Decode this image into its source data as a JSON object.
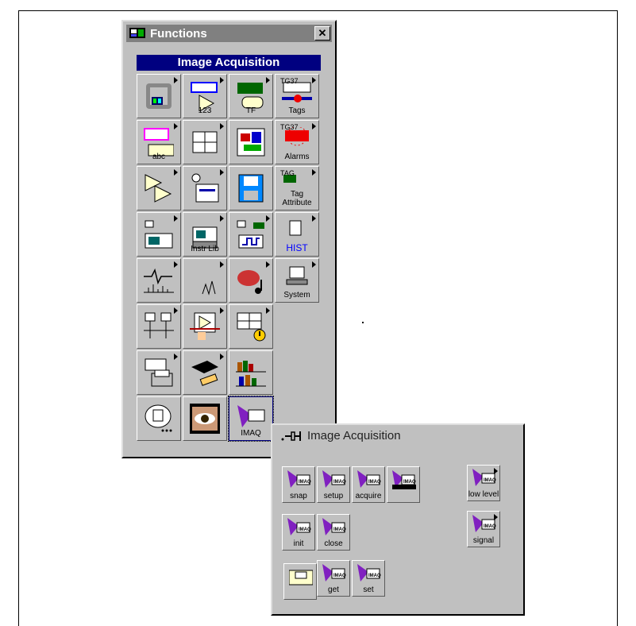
{
  "functions_window": {
    "title": "Functions",
    "close_glyph": "✕",
    "palette_title": "Image Acquisition",
    "cells": [
      {
        "label": "",
        "icon": "structures-icon"
      },
      {
        "label": "123",
        "icon": "numeric-icon"
      },
      {
        "label": "TF",
        "icon": "boolean-icon"
      },
      {
        "label": "Tags",
        "icon": "tags-icon",
        "top_text": "TG37"
      },
      {
        "label": "abc",
        "icon": "string-icon"
      },
      {
        "label": "",
        "icon": "array-icon"
      },
      {
        "label": "",
        "icon": "cluster-icon"
      },
      {
        "label": "Alarms",
        "icon": "alarms-icon",
        "top_text": "TG37"
      },
      {
        "label": "",
        "icon": "comparison-icon"
      },
      {
        "label": "",
        "icon": "time-dialog-icon"
      },
      {
        "label": "",
        "icon": "file-io-icon"
      },
      {
        "label": "Tag Attribute",
        "icon": "tag-attribute-icon",
        "top_text": "TAG"
      },
      {
        "label": "",
        "icon": "daq-icon"
      },
      {
        "label": "Instr Lib",
        "icon": "instrument-library-icon"
      },
      {
        "label": "",
        "icon": "instrument-io-icon"
      },
      {
        "label": "HIST",
        "icon": "historical-icon"
      },
      {
        "label": "",
        "icon": "analysis-icon"
      },
      {
        "label": "",
        "icon": "mathematics-icon"
      },
      {
        "label": "",
        "icon": "sound-icon"
      },
      {
        "label": "System",
        "icon": "system-icon"
      },
      {
        "label": "",
        "icon": "communication-icon"
      },
      {
        "label": "",
        "icon": "application-control-icon"
      },
      {
        "label": "",
        "icon": "advanced-error-icon"
      },
      {
        "label": "",
        "icon": "empty"
      },
      {
        "label": "",
        "icon": "report-icon"
      },
      {
        "label": "",
        "icon": "tutorial-icon"
      },
      {
        "label": "",
        "icon": "user-libraries-icon"
      },
      {
        "label": "",
        "icon": "empty"
      },
      {
        "label": "",
        "icon": "select-vi-icon"
      },
      {
        "label": "",
        "icon": "vision-icon"
      },
      {
        "label": "IMAQ",
        "icon": "imaq-icon"
      }
    ]
  },
  "ia_palette": {
    "title": "Image Acquisition",
    "items": [
      {
        "label": "snap"
      },
      {
        "label": "setup"
      },
      {
        "label": "acquire"
      },
      {
        "label": ""
      },
      {
        "label": "low level"
      },
      {
        "label": "init"
      },
      {
        "label": "close"
      },
      {
        "label": "signal"
      },
      {
        "label": ""
      },
      {
        "label": "get"
      },
      {
        "label": "set"
      }
    ],
    "imaq_text": "IMAQ"
  }
}
